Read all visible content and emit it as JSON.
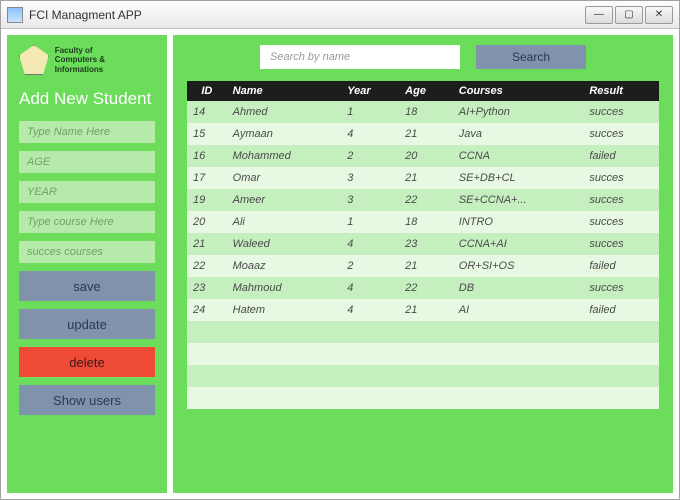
{
  "window": {
    "title": "FCI Managment APP"
  },
  "sidebar": {
    "logo_line1": "Faculty of",
    "logo_line2": "Computers & Informations",
    "heading": "Add New Student",
    "fields": {
      "name_ph": "Type Name Here",
      "age_ph": "AGE",
      "year_ph": "YEAR",
      "course_ph": "Type course Here",
      "success_ph": "succes courses"
    },
    "buttons": {
      "save": "save",
      "update": "update",
      "delete": "delete",
      "show": "Show users"
    }
  },
  "search": {
    "placeholder": "Search by name",
    "button": "Search"
  },
  "table": {
    "headers": [
      "ID",
      "Name",
      "Year",
      "Age",
      "Courses",
      "Result"
    ],
    "rows": [
      {
        "id": "14",
        "name": "Ahmed",
        "year": "1",
        "age": "18",
        "courses": "AI+Python",
        "result": "succes"
      },
      {
        "id": "15",
        "name": "Aymaan",
        "year": "4",
        "age": "21",
        "courses": "Java",
        "result": "succes"
      },
      {
        "id": "16",
        "name": "Mohammed",
        "year": "2",
        "age": "20",
        "courses": "CCNA",
        "result": "failed"
      },
      {
        "id": "17",
        "name": "Omar",
        "year": "3",
        "age": "21",
        "courses": "SE+DB+CL",
        "result": "succes"
      },
      {
        "id": "19",
        "name": "Ameer",
        "year": "3",
        "age": "22",
        "courses": "SE+CCNA+...",
        "result": "succes"
      },
      {
        "id": "20",
        "name": "Ali",
        "year": "1",
        "age": "18",
        "courses": "INTRO",
        "result": "succes"
      },
      {
        "id": "21",
        "name": "Waleed",
        "year": "4",
        "age": "23",
        "courses": "CCNA+AI",
        "result": "succes"
      },
      {
        "id": "22",
        "name": "Moaaz",
        "year": "2",
        "age": "21",
        "courses": "OR+SI+OS",
        "result": "failed"
      },
      {
        "id": "23",
        "name": "Mahmoud",
        "year": "4",
        "age": "22",
        "courses": "DB",
        "result": "succes"
      },
      {
        "id": "24",
        "name": "Hatem",
        "year": "4",
        "age": "21",
        "courses": "AI",
        "result": "failed"
      }
    ],
    "empty_rows": 4
  }
}
